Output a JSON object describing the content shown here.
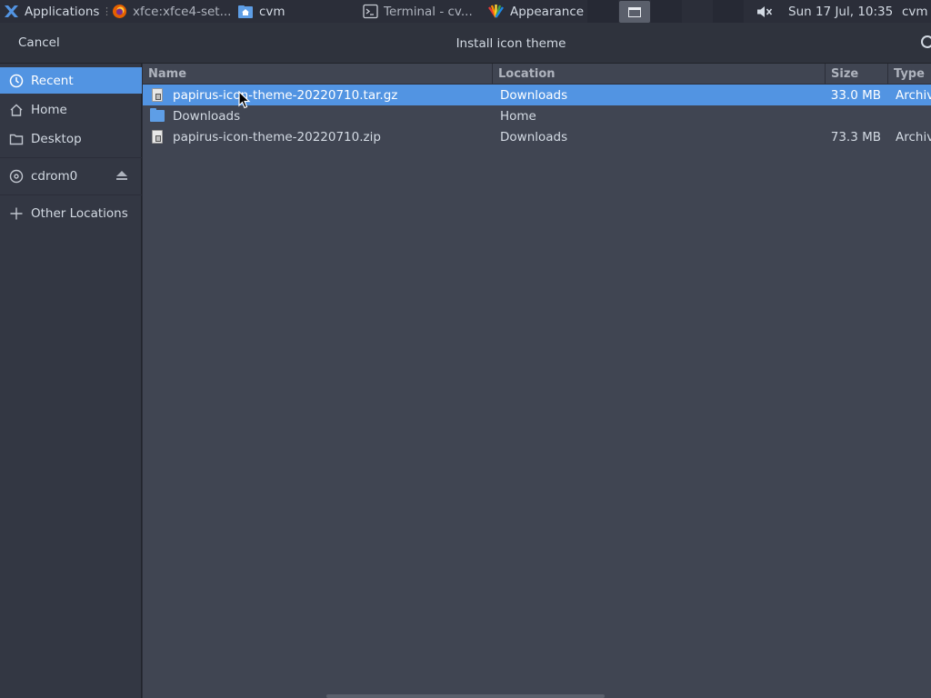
{
  "panel": {
    "applications_label": "Applications",
    "tasks": [
      {
        "label": "xfce:xfce4-set...",
        "icon": "firefox-icon"
      },
      {
        "label": "cvm",
        "icon": "home-folder-icon"
      },
      {
        "label": "Terminal - cv...",
        "icon": "terminal-icon"
      },
      {
        "label": "Appearance",
        "icon": "appearance-icon"
      }
    ],
    "clock": "Sun 17 Jul, 10:35",
    "user": "cvm",
    "volume_icon": "volume-muted-icon"
  },
  "dialog": {
    "title": "Install icon theme",
    "cancel_label": "Cancel"
  },
  "sidebar": {
    "items": [
      {
        "label": "Recent",
        "icon": "recent-clock-icon",
        "selected": true
      },
      {
        "label": "Home",
        "icon": "home-icon"
      },
      {
        "label": "Desktop",
        "icon": "desktop-folder-icon"
      },
      {
        "label": "cdrom0",
        "icon": "disc-icon",
        "action_icon": "eject-icon"
      },
      {
        "label": "Other Locations",
        "icon": "plus-icon"
      }
    ]
  },
  "filelist": {
    "columns": [
      "Name",
      "Location",
      "Size",
      "Type"
    ],
    "rows": [
      {
        "name": "papirus-icon-theme-20220710.tar.gz",
        "location": "Downloads",
        "size": "33.0 MB",
        "type": "Archive",
        "icon": "archive-icon",
        "selected": true
      },
      {
        "name": "Downloads",
        "location": "Home",
        "size": "",
        "type": "",
        "icon": "folder-icon",
        "selected": false
      },
      {
        "name": "papirus-icon-theme-20220710.zip",
        "location": "Downloads",
        "size": "73.3 MB",
        "type": "Archive",
        "icon": "archive-icon",
        "selected": false
      }
    ]
  },
  "colors": {
    "accent": "#5294e2",
    "background": "#404552",
    "sidebar": "#333743"
  }
}
